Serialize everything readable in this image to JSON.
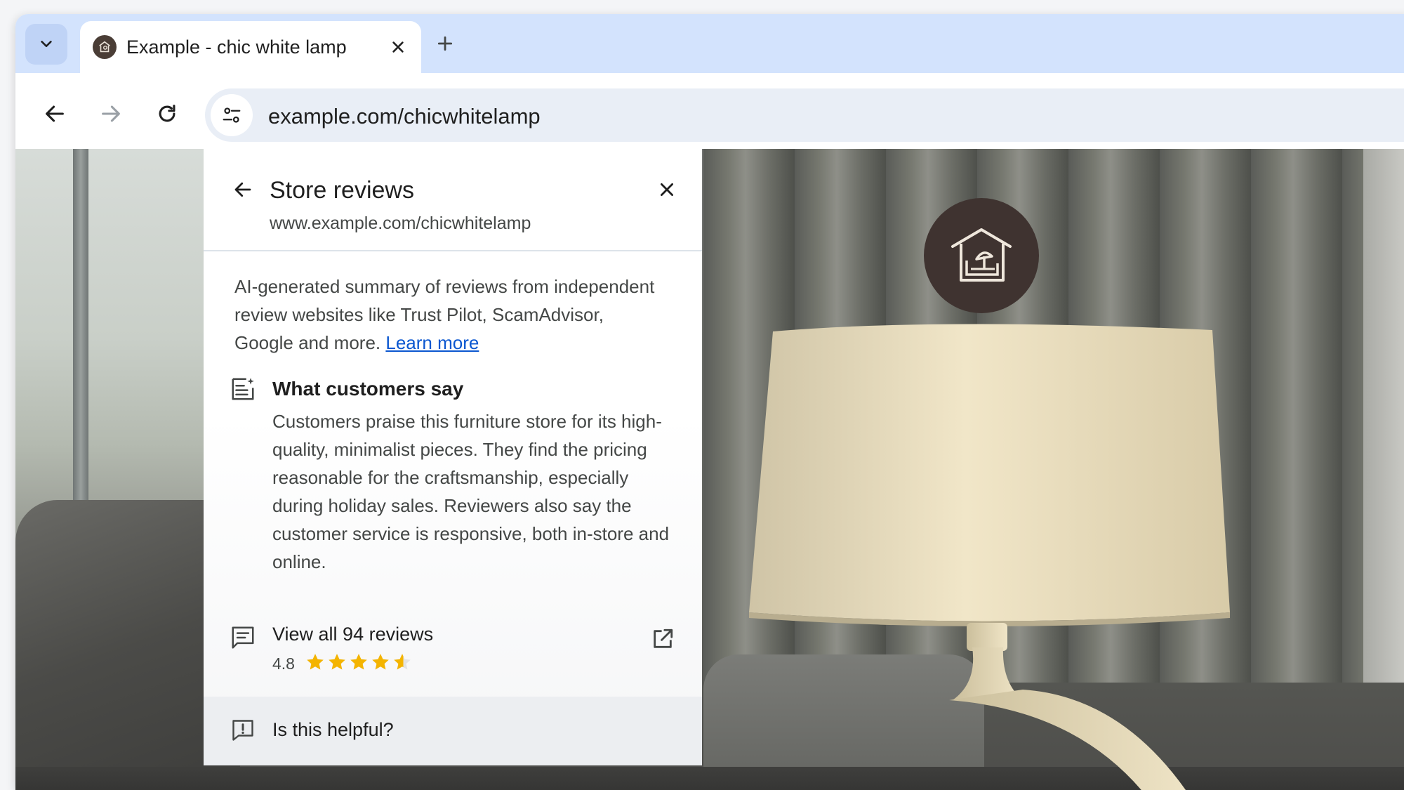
{
  "browser": {
    "tab": {
      "title": "Example - chic white lamp",
      "favicon": "store-logo-icon"
    },
    "omnibox": {
      "url": "example.com/chicwhitelamp"
    }
  },
  "panel": {
    "title": "Store reviews",
    "url": "www.example.com/chicwhitelamp",
    "summary_text": "AI-generated summary of reviews from independent review websites like Trust Pilot, ScamAdvisor, Google and more.",
    "learn_more": "Learn more",
    "customers": {
      "heading": "What customers say",
      "body": "Customers praise this furniture store for its high-quality, minimalist pieces. They find the pricing reasonable for the craftsmanship, especially during holiday sales. Reviewers also say the customer service is responsive, both in-store and online."
    },
    "reviews": {
      "label": "View all 94 reviews",
      "rating_text": "4.8",
      "rating_value": 4.8,
      "rating_max": 5
    },
    "feedback": {
      "label": "Is this helpful?"
    }
  },
  "colors": {
    "tabstrip": "#d3e3fd",
    "omnibox": "#e9eef6",
    "link": "#0b57d0",
    "star": "#f4b400",
    "logo_badge": "#3f3330"
  }
}
